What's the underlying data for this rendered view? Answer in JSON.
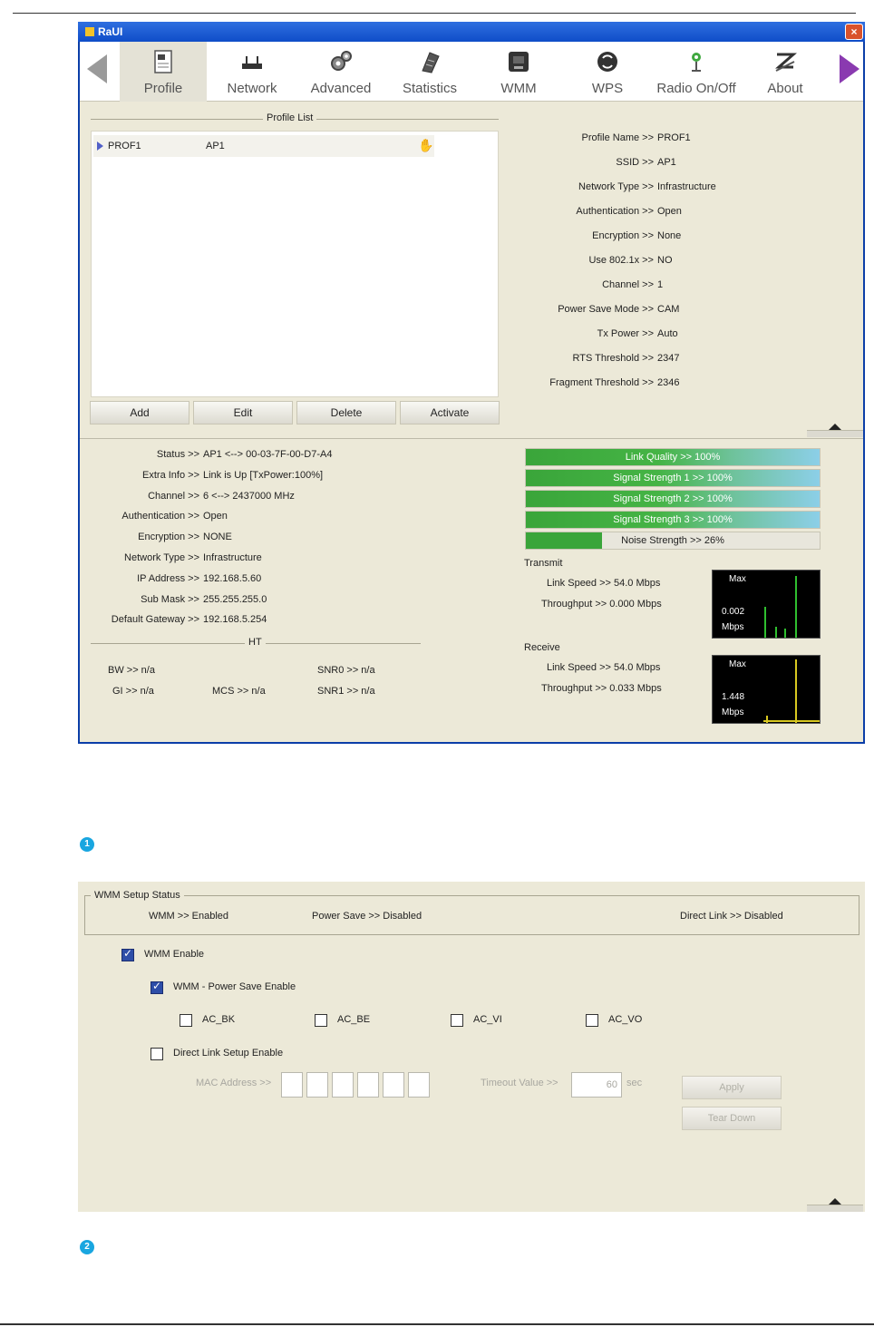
{
  "window1": {
    "title": "RaUI",
    "close_glyph": "×",
    "toolbar": [
      {
        "label": "Profile",
        "icon": "profile-icon"
      },
      {
        "label": "Network",
        "icon": "network-icon"
      },
      {
        "label": "Advanced",
        "icon": "advanced-icon"
      },
      {
        "label": "Statistics",
        "icon": "statistics-icon"
      },
      {
        "label": "WMM",
        "icon": "wmm-icon"
      },
      {
        "label": "WPS",
        "icon": "wps-icon"
      },
      {
        "label": "Radio On/Off",
        "icon": "radio-icon"
      },
      {
        "label": "About",
        "icon": "about-icon"
      }
    ],
    "profile_list": {
      "legend": "Profile List",
      "rows": [
        {
          "name": "PROF1",
          "ssid": "AP1"
        }
      ],
      "buttons": [
        "Add",
        "Edit",
        "Delete",
        "Activate"
      ]
    },
    "profile_details": [
      {
        "key": "Profile Name >>",
        "value": "PROF1"
      },
      {
        "key": "SSID >>",
        "value": "AP1"
      },
      {
        "key": "Network Type >>",
        "value": "Infrastructure"
      },
      {
        "key": "Authentication >>",
        "value": "Open"
      },
      {
        "key": "Encryption >>",
        "value": "None"
      },
      {
        "key": "Use 802.1x >>",
        "value": "NO"
      },
      {
        "key": "Channel >>",
        "value": "1"
      },
      {
        "key": "Power Save Mode >>",
        "value": "CAM"
      },
      {
        "key": "Tx Power >>",
        "value": "Auto"
      },
      {
        "key": "RTS Threshold >>",
        "value": "2347"
      },
      {
        "key": "Fragment Threshold >>",
        "value": "2346"
      }
    ],
    "status": [
      {
        "key": "Status >>",
        "value": "AP1 <--> 00-03-7F-00-D7-A4"
      },
      {
        "key": "Extra Info >>",
        "value": "Link is Up [TxPower:100%]"
      },
      {
        "key": "Channel >>",
        "value": "6 <--> 2437000 MHz"
      },
      {
        "key": "Authentication >>",
        "value": "Open"
      },
      {
        "key": "Encryption >>",
        "value": "NONE"
      },
      {
        "key": "Network Type >>",
        "value": "Infrastructure"
      },
      {
        "key": "IP Address >>",
        "value": "192.168.5.60"
      },
      {
        "key": "Sub Mask >>",
        "value": "255.255.255.0"
      },
      {
        "key": "Default Gateway >>",
        "value": "192.168.5.254"
      }
    ],
    "ht": {
      "legend": "HT",
      "bw": "BW >> n/a",
      "gi": "GI >> n/a",
      "mcs": "MCS >> n/a",
      "snr0": "SNR0 >> n/a",
      "snr1": "SNR1 >> n/a"
    },
    "signal_bars": [
      {
        "label": "Link Quality >> 100%",
        "percent": 100
      },
      {
        "label": "Signal Strength 1 >> 100%",
        "percent": 100
      },
      {
        "label": "Signal Strength 2 >> 100%",
        "percent": 100
      },
      {
        "label": "Signal Strength 3 >> 100%",
        "percent": 100
      }
    ],
    "noise": {
      "label": "Noise Strength >> 26%",
      "percent": 26
    },
    "transmit": {
      "label": "Transmit",
      "link_speed": "Link Speed >> 54.0 Mbps",
      "throughput": "Throughput >> 0.000 Mbps",
      "graph_max": "Max",
      "graph_value": "0.002",
      "graph_unit": "Mbps",
      "line_color": "#2fbf2f"
    },
    "receive": {
      "label": "Receive",
      "link_speed": "Link Speed >> 54.0 Mbps",
      "throughput": "Throughput >> 0.033 Mbps",
      "graph_max": "Max",
      "graph_value": "1.448",
      "graph_unit": "Mbps",
      "line_color": "#d8c820"
    }
  },
  "step_markers": [
    "1",
    "2"
  ],
  "window2": {
    "legend": "WMM Setup Status",
    "status": {
      "wmm": "WMM >> Enabled",
      "power_save": "Power Save >> Disabled",
      "direct_link": "Direct Link >> Disabled"
    },
    "wmm_enable": {
      "label": "WMM Enable",
      "checked": true
    },
    "power_save_enable": {
      "label": "WMM - Power Save Enable",
      "checked": true
    },
    "ac_options": [
      {
        "label": "AC_BK",
        "checked": false
      },
      {
        "label": "AC_BE",
        "checked": false
      },
      {
        "label": "AC_VI",
        "checked": false
      },
      {
        "label": "AC_VO",
        "checked": false
      }
    ],
    "direct_link_enable": {
      "label": "Direct Link Setup Enable",
      "checked": false
    },
    "mac_label": "MAC Address >>",
    "timeout_label": "Timeout Value >>",
    "timeout_value": "60",
    "timeout_unit": "sec",
    "apply_label": "Apply",
    "tear_down_label": "Tear Down"
  }
}
